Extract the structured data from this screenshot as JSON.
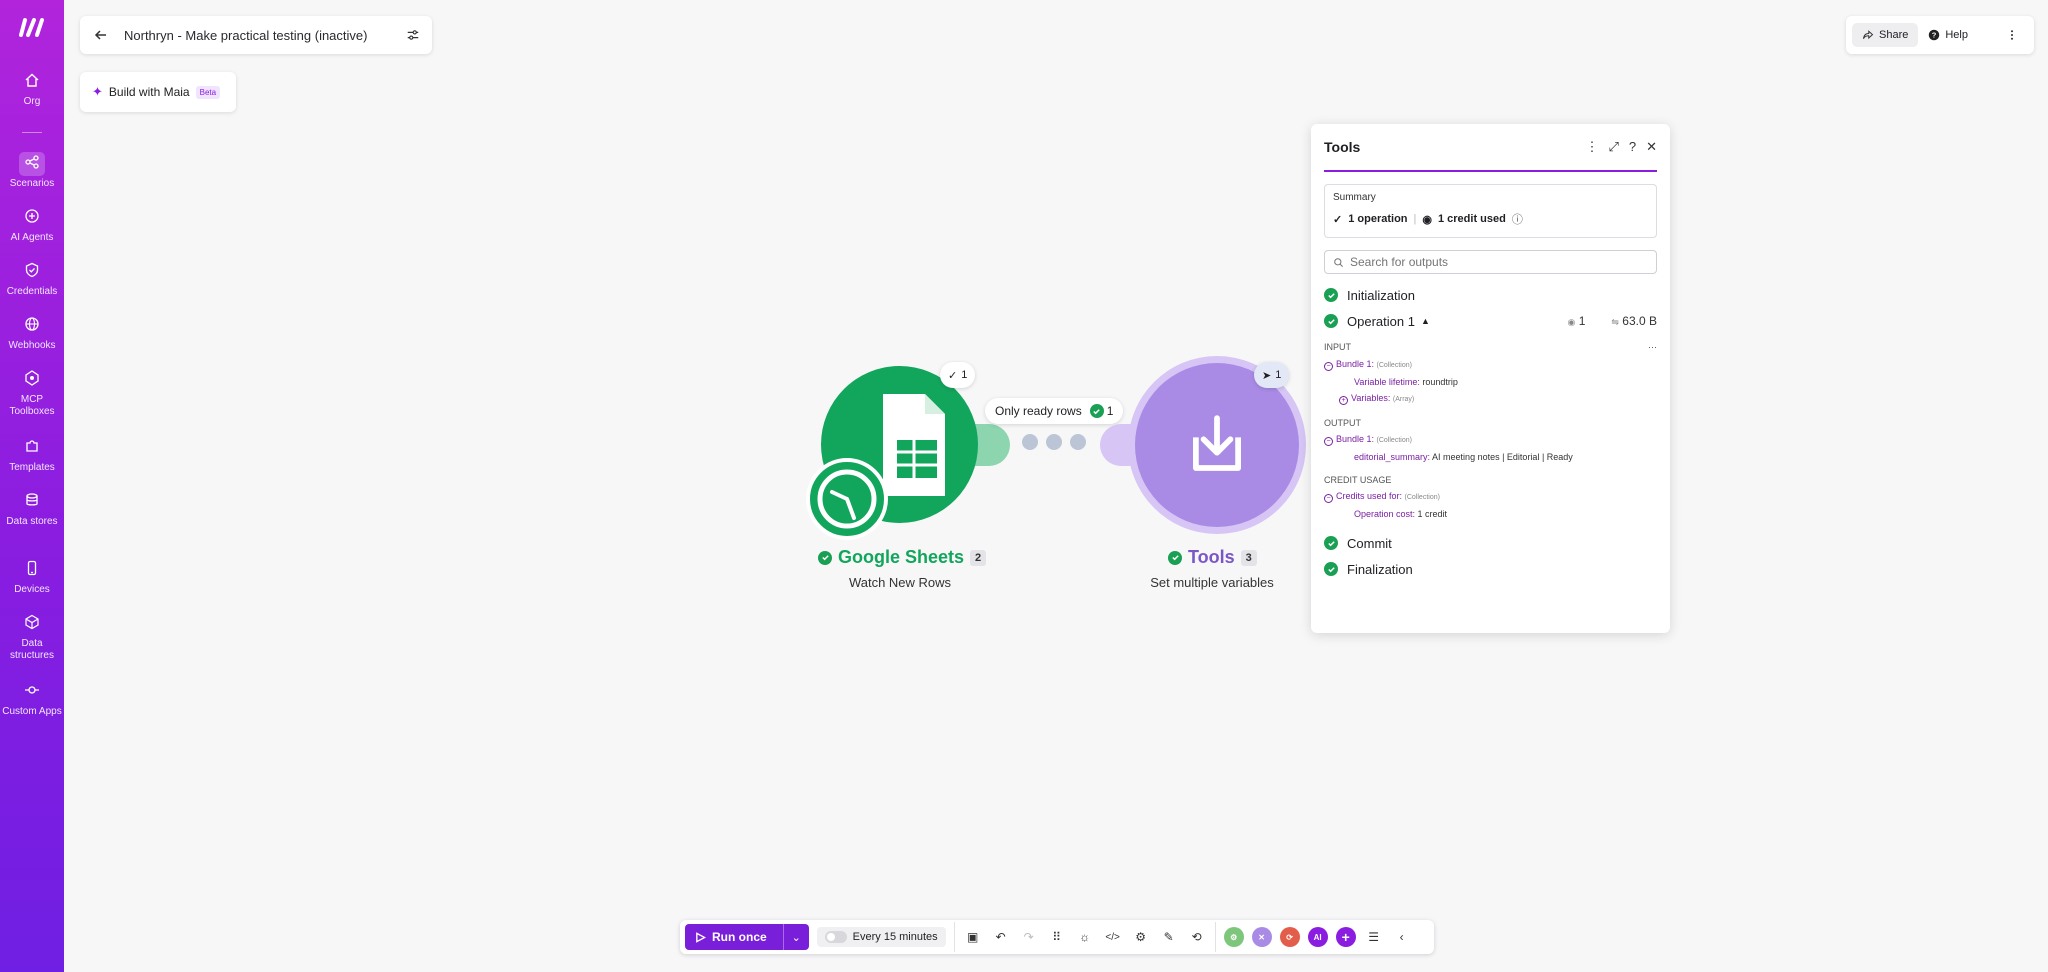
{
  "sidebar": {
    "items": [
      {
        "label": "Org",
        "icon": "home-icon"
      },
      {
        "label": "Scenarios",
        "icon": "share-nodes-icon"
      },
      {
        "label": "AI Agents",
        "icon": "ai-agent-icon"
      },
      {
        "label": "Credentials",
        "icon": "shield-icon"
      },
      {
        "label": "Webhooks",
        "icon": "globe-icon"
      },
      {
        "label": "MCP Toolboxes",
        "icon": "mcp-icon"
      },
      {
        "label": "Templates",
        "icon": "puzzle-icon"
      },
      {
        "label": "Data stores",
        "icon": "database-icon"
      },
      {
        "label": "Devices",
        "icon": "phone-icon"
      },
      {
        "label": "Data structures",
        "icon": "cube-icon"
      },
      {
        "label": "Custom Apps",
        "icon": "commit-icon"
      }
    ]
  },
  "header": {
    "title": "Northryn - Make practical testing (inactive)",
    "maia_label": "Build with Maia",
    "maia_badge": "Beta",
    "share_label": "Share",
    "help_label": "Help"
  },
  "canvas": {
    "sheets": {
      "name": "Google Sheets",
      "number": "2",
      "subtitle": "Watch New Rows",
      "ops_badge": "1"
    },
    "filter": {
      "label": "Only ready rows",
      "count": "1"
    },
    "tools": {
      "name": "Tools",
      "number": "3",
      "subtitle": "Set multiple variables",
      "ops_badge": "1"
    }
  },
  "panel": {
    "title": "Tools",
    "summary_label": "Summary",
    "operations": "1 operation",
    "credits": "1 credit used",
    "search_placeholder": "Search for outputs",
    "steps": {
      "init": "Initialization",
      "op": "Operation 1",
      "op_ops": "1",
      "op_size": "63.0 B",
      "commit": "Commit",
      "final": "Finalization"
    },
    "input_title": "INPUT",
    "input_bundle": "Bundle 1:",
    "input_bundle_type": "(Collection)",
    "var_lifetime_key": "Variable lifetime:",
    "var_lifetime_val": "roundtrip",
    "variables_key": "Variables:",
    "variables_type": "(Array)",
    "output_title": "OUTPUT",
    "output_bundle": "Bundle 1:",
    "output_bundle_type": "(Collection)",
    "editorial_key": "editorial_summary:",
    "editorial_val": "AI meeting notes | Editorial | Ready",
    "credit_title": "CREDIT USAGE",
    "credits_key": "Credits used for:",
    "credits_type": "(Collection)",
    "op_cost_key": "Operation cost:",
    "op_cost_val": "1 credit"
  },
  "toolbar": {
    "run_label": "Run once",
    "schedule_label": "Every 15 minutes",
    "app_ai_label": "AI"
  },
  "colors": {
    "brand": "#8a1de0",
    "sheets_green": "#12a55c",
    "tools_purple": "#a98be6",
    "success": "#1aa055"
  }
}
